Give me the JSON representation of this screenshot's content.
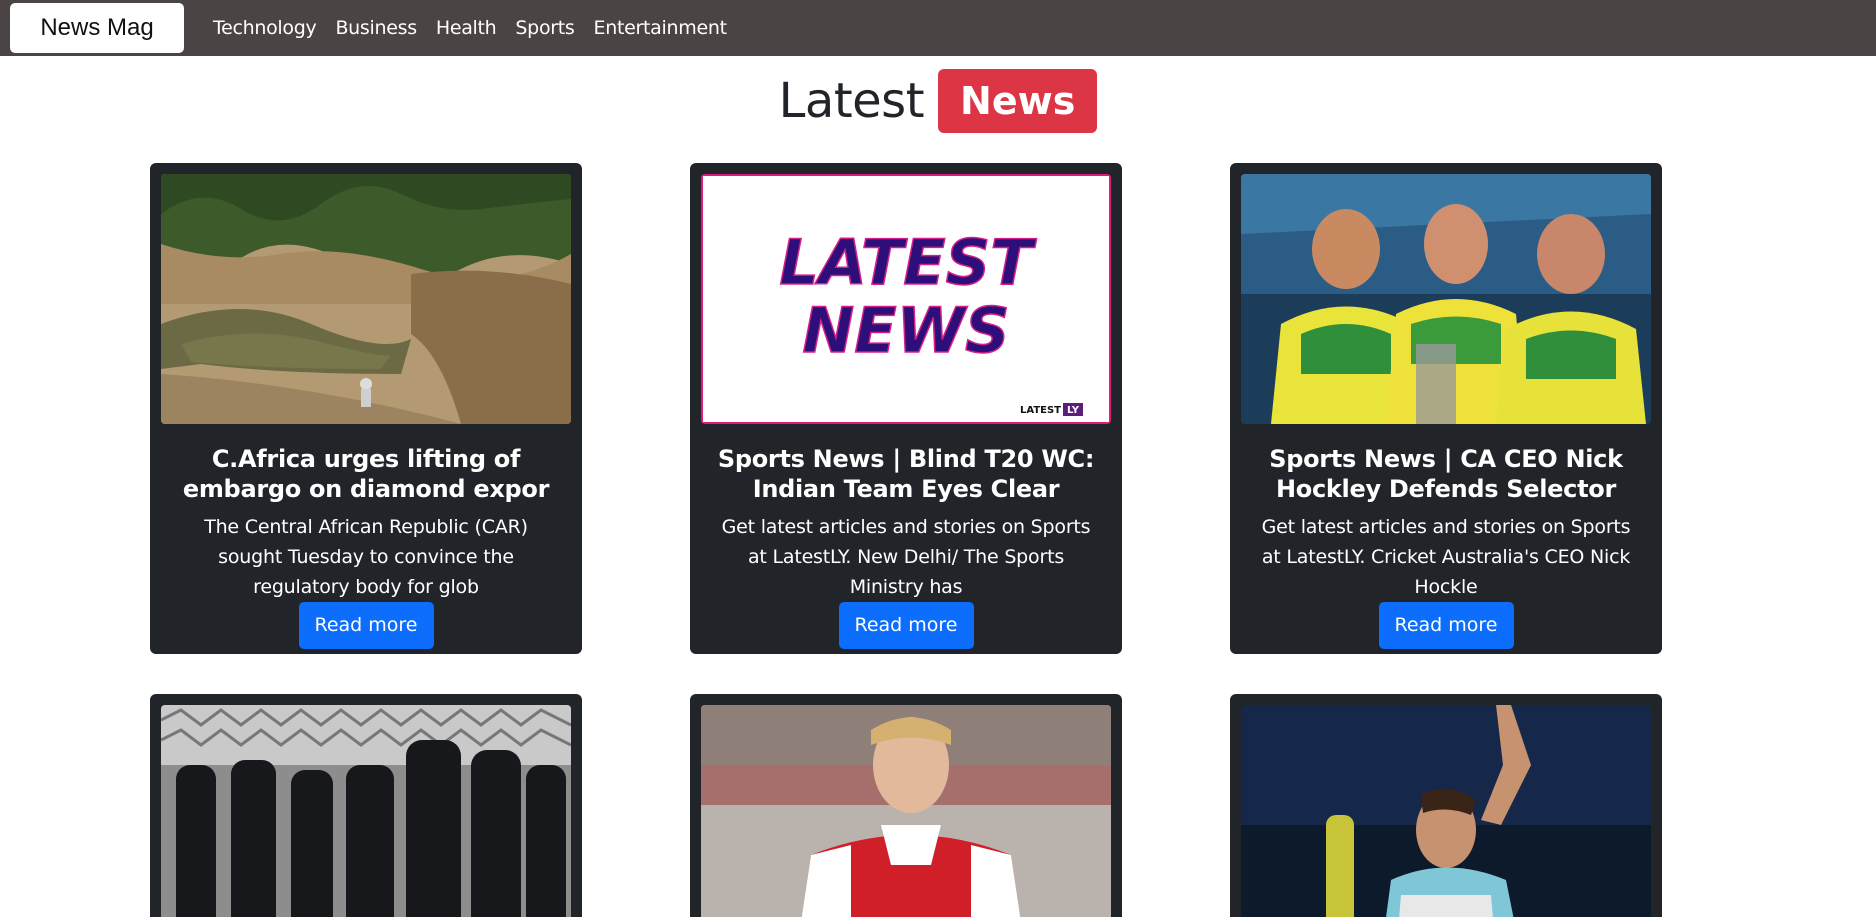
{
  "navbar": {
    "brand": "News Mag",
    "links": [
      "Technology",
      "Business",
      "Health",
      "Sports",
      "Entertainment"
    ]
  },
  "heading": {
    "text": "Latest",
    "badge": "News"
  },
  "cards": [
    {
      "title": "C.Africa urges lifting of embargo on diamond expor",
      "text": "The Central African Republic (CAR) sought Tuesday to convince the regulatory body for glob",
      "button": "Read more",
      "image": "diamond-mine-photo"
    },
    {
      "title": "Sports News | Blind T20 WC: Indian Team Eyes Clear",
      "text": "Get latest articles and stories on Sports at LatestLY. New Delhi/ The Sports Ministry has",
      "button": "Read more",
      "image": "latest-news-logo",
      "image_text": {
        "line1": "LATEST",
        "line2": "NEWS",
        "corner": "LATEST",
        "corner_badge": "LY"
      }
    },
    {
      "title": "Sports News | CA CEO Nick Hockley Defends Selector",
      "text": "Get latest articles and stories on Sports at LatestLY. Cricket Australia's CEO Nick Hockle",
      "button": "Read more",
      "image": "cricket-players-photo"
    },
    {
      "image": "police-officers-photo"
    },
    {
      "image": "football-player-photo"
    },
    {
      "image": "tennis-player-photo"
    }
  ],
  "colors": {
    "navbar_bg": "#4a4444",
    "card_bg": "#212529",
    "badge_red": "#dc3545",
    "button_blue": "#0d6efd"
  }
}
